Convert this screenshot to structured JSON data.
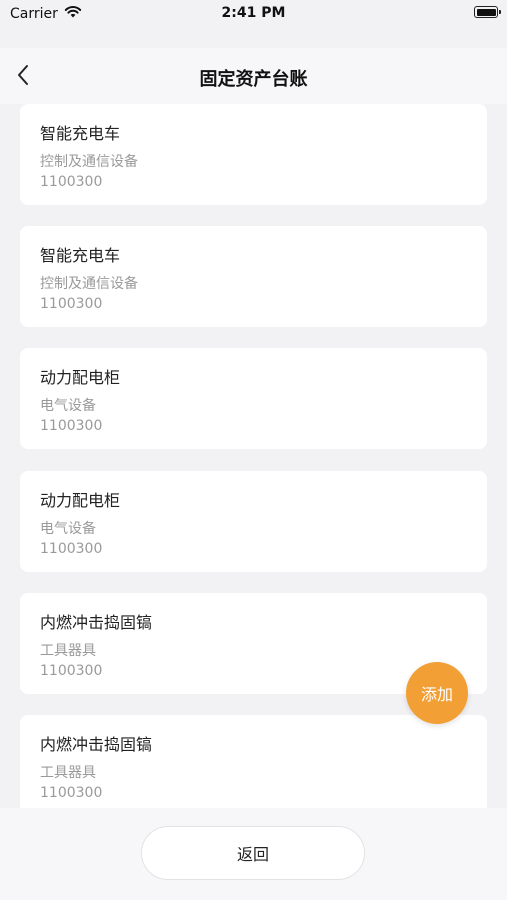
{
  "status_bar": {
    "carrier": "Carrier",
    "time": "2:41 PM"
  },
  "nav": {
    "title": "固定资产台账"
  },
  "assets": [
    {
      "name": "智能充电车",
      "category": "控制及通信设备",
      "code": "1100300"
    },
    {
      "name": "智能充电车",
      "category": "控制及通信设备",
      "code": "1100300"
    },
    {
      "name": "动力配电柜",
      "category": "电气设备",
      "code": "1100300"
    },
    {
      "name": "动力配电柜",
      "category": "电气设备",
      "code": "1100300"
    },
    {
      "name": "内燃冲击捣固镐",
      "category": "工具器具",
      "code": "1100300"
    },
    {
      "name": "内燃冲击捣固镐",
      "category": "工具器具",
      "code": "1100300"
    }
  ],
  "fab": {
    "label": "添加"
  },
  "footer": {
    "return_label": "返回"
  },
  "colors": {
    "accent": "#f2a035",
    "background": "#f2f2f4",
    "card": "#ffffff",
    "secondary_text": "#9a9a9a"
  },
  "icons": {
    "back": "chevron-left-icon",
    "wifi": "wifi-icon",
    "battery": "battery-icon"
  }
}
